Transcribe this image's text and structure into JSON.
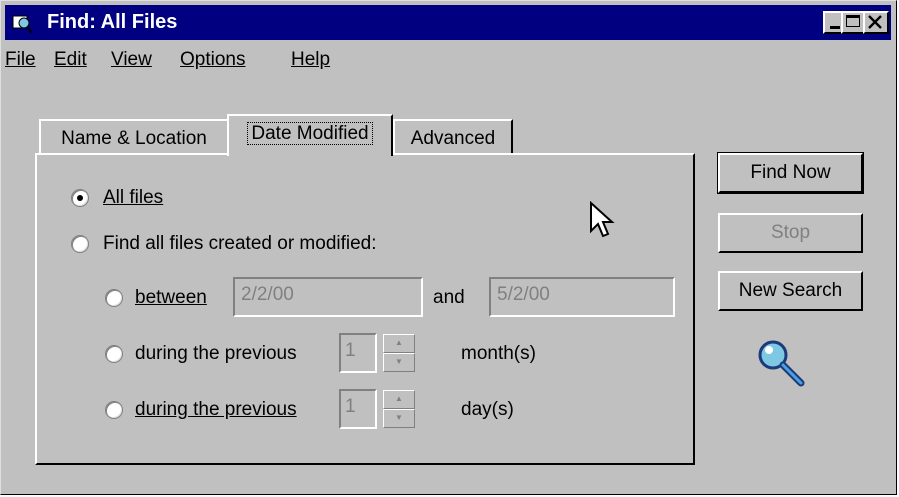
{
  "window": {
    "title": "Find: All Files",
    "menu": [
      "File",
      "Edit",
      "View",
      "Options",
      "Help"
    ]
  },
  "tabs": [
    {
      "label": "Name & Location",
      "active": false
    },
    {
      "label": "Date Modified",
      "active": true
    },
    {
      "label": "Advanced",
      "active": false
    }
  ],
  "options": {
    "all_files": "All files",
    "find_all": "Find all files created or modified:",
    "between": "between",
    "between_from": "2/2/00",
    "and": "and",
    "between_to": "5/2/00",
    "prev_months_label": "during the previous",
    "prev_months_value": "1",
    "months_unit": "month(s)",
    "prev_days_label": "during the previous",
    "prev_days_value": "1",
    "days_unit": "day(s)"
  },
  "buttons": {
    "find_now": "Find Now",
    "stop": "Stop",
    "new_search": "New Search"
  },
  "colors": {
    "titlebar": "#000080",
    "face": "#c0c0c0"
  },
  "icons": [
    "find-icon",
    "magnifier-icon",
    "mouse-cursor-icon"
  ]
}
